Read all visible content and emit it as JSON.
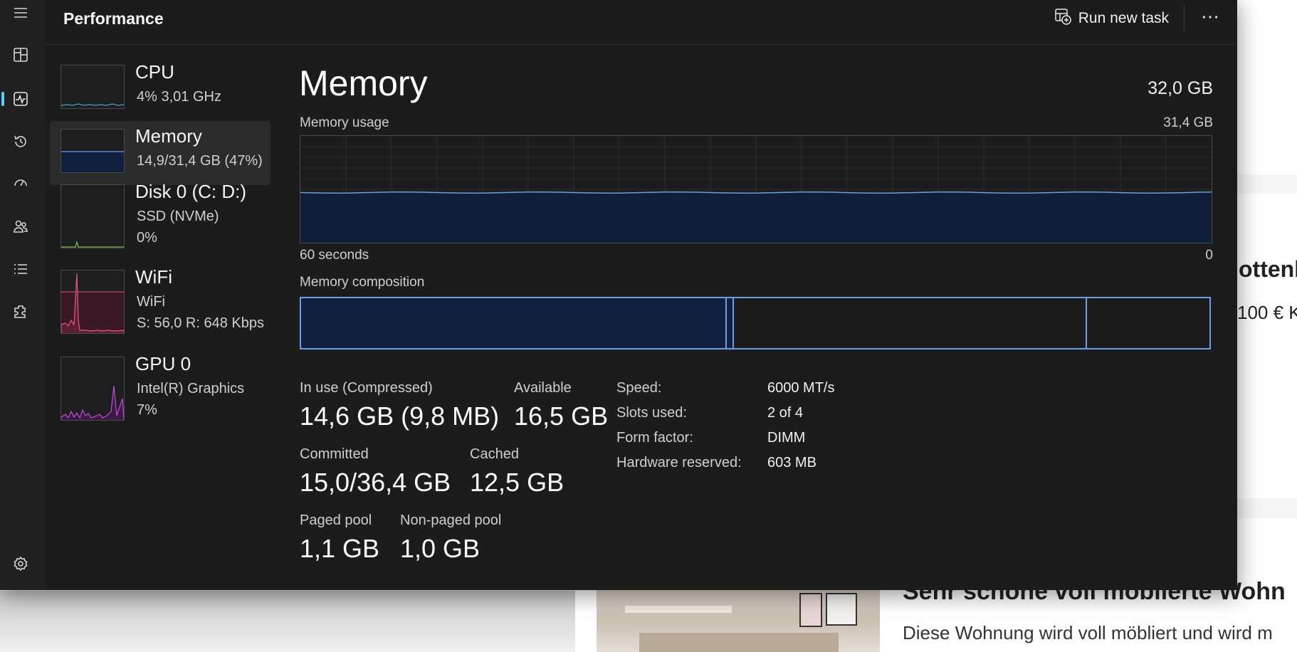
{
  "window": {
    "title": "Performance",
    "run_new_task": "Run new task",
    "more_label": "⋯"
  },
  "rail": [
    {
      "icon": "hamburger-menu-icon"
    },
    {
      "icon": "processes-icon"
    },
    {
      "icon": "performance-icon",
      "active": true
    },
    {
      "icon": "app-history-icon"
    },
    {
      "icon": "startup-apps-icon"
    },
    {
      "icon": "users-icon"
    },
    {
      "icon": "details-icon"
    },
    {
      "icon": "services-icon"
    },
    {
      "icon": "settings-icon"
    }
  ],
  "sidebar": {
    "items": [
      {
        "name": "CPU",
        "line1": "4% 3,01 GHz",
        "line2": "",
        "line3": ""
      },
      {
        "name": "Memory",
        "line1": "14,9/31,4 GB (47%)",
        "line2": "",
        "line3": "",
        "selected": true
      },
      {
        "name": "Disk 0 (C: D:)",
        "line1": "SSD (NVMe)",
        "line2": "0%",
        "line3": ""
      },
      {
        "name": "WiFi",
        "line1": "WiFi",
        "line2": "S: 56,0  R: 648 Kbps",
        "line3": ""
      },
      {
        "name": "GPU 0",
        "line1": "Intel(R) Graphics",
        "line2": "7%",
        "line3": ""
      }
    ]
  },
  "main": {
    "title": "Memory",
    "total": "32,0 GB",
    "usage_label": "Memory usage",
    "usage_max": "31,4 GB",
    "axis_left": "60 seconds",
    "axis_right": "0",
    "composition_label": "Memory composition",
    "in_use_label": "In use (Compressed)",
    "in_use_value": "14,6 GB (9,8 MB)",
    "available_label": "Available",
    "available_value": "16,5 GB",
    "committed_label": "Committed",
    "committed_value": "15,0/36,4 GB",
    "cached_label": "Cached",
    "cached_value": "12,5 GB",
    "paged_label": "Paged pool",
    "paged_value": "1,1 GB",
    "nonpaged_label": "Non-paged pool",
    "nonpaged_value": "1,0 GB",
    "speed_label": "Speed:",
    "speed_value": "6000 MT/s",
    "slots_label": "Slots used:",
    "slots_value": "2 of 4",
    "form_label": "Form factor:",
    "form_value": "DIMM",
    "hwres_label": "Hardware reserved:",
    "hwres_value": "603 MB",
    "usage_fraction": 0.47
  },
  "background": {
    "heading1": "ottenb",
    "price": "100 € K",
    "heading2": "Sehr schöne voll möblierte Wohn",
    "desc": "Diese Wohnung wird voll möbliert und wird m"
  },
  "colors": {
    "memory_fill": "#0f1f3d",
    "memory_line": "#6a9fe8",
    "cpu_line": "#3aa7d8",
    "wifi_line": "#e05a82",
    "gpu_line": "#c34fd6",
    "disk_line": "#7ec34a"
  }
}
